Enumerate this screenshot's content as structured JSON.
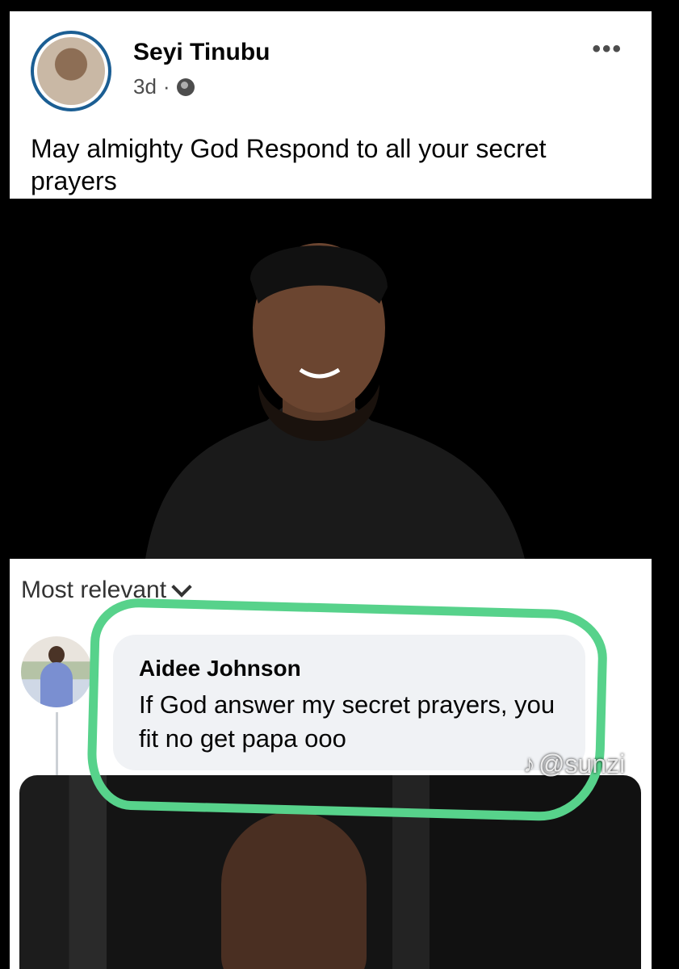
{
  "post": {
    "author": "Seyi Tinubu",
    "age": "3d",
    "separator": "·",
    "more_label": "•••",
    "text": "May almighty God Respond to all your secret prayers",
    "audience_icon": "globe-icon"
  },
  "comments": {
    "sort_label": "Most relevant",
    "items": [
      {
        "author": "Aidee Johnson",
        "text": "If God answer my secret prayers, you fit no get papa ooo"
      }
    ]
  },
  "watermark": {
    "icon": "tiktok-icon",
    "handle": "@sunzi"
  },
  "colors": {
    "highlight": "#57d28b",
    "avatar_ring": "#1b5e93",
    "bubble": "#f0f2f5"
  }
}
